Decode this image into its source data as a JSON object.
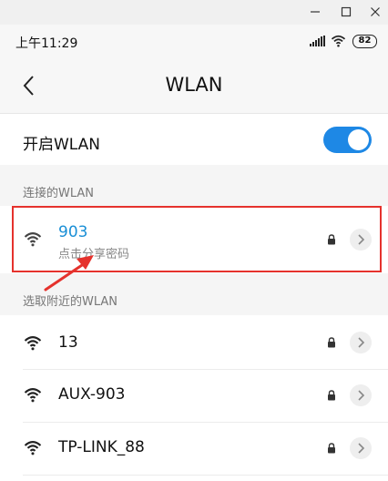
{
  "window": {
    "minimize": "—",
    "maximize": "☐",
    "close": "✕"
  },
  "status": {
    "time": "上午11:29",
    "battery": "82"
  },
  "header": {
    "title": "WLAN"
  },
  "toggle": {
    "label": "开启WLAN",
    "state": "on"
  },
  "connected": {
    "section_label": "连接的WLAN",
    "network": {
      "name": "903",
      "subtitle": "点击分享密码",
      "locked": true
    }
  },
  "nearby": {
    "section_label": "选取附近的WLAN",
    "networks": [
      {
        "name": "13",
        "locked": true
      },
      {
        "name": "AUX-903",
        "locked": true
      },
      {
        "name": "TP-LINK_88",
        "locked": true
      }
    ]
  },
  "colors": {
    "accent": "#1e88e5",
    "highlight_box": "#e5322d",
    "connected_text": "#1a8fd6"
  }
}
